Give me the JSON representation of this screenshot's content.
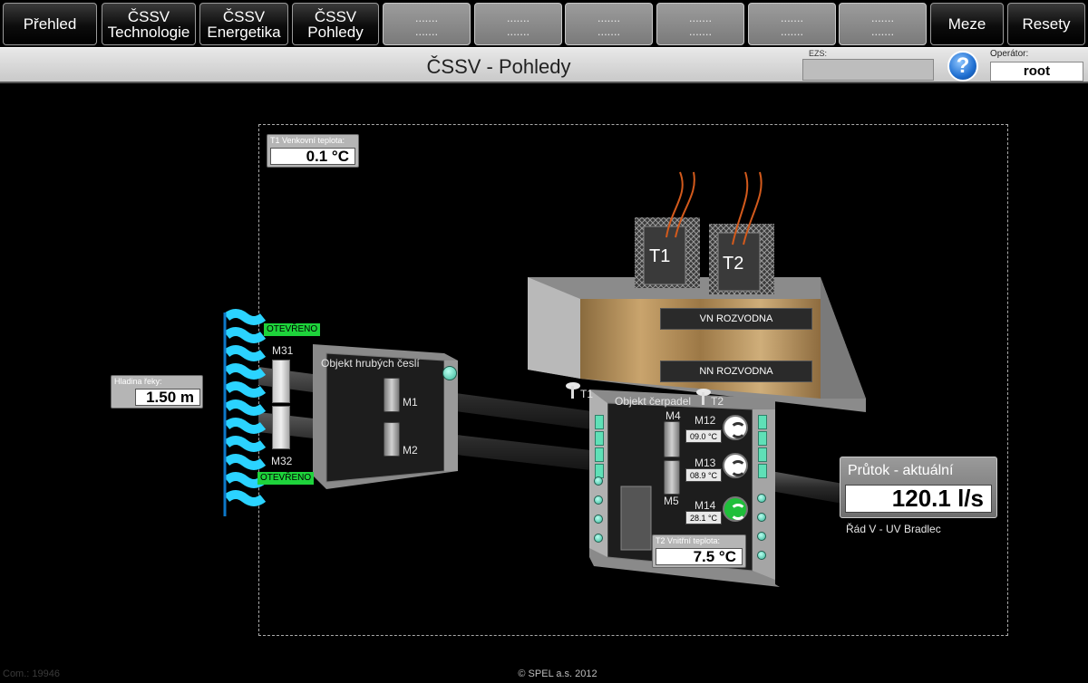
{
  "nav": {
    "btn_prehled": "Přehled",
    "btn_tech_1": "ČSSV",
    "btn_tech_2": "Technologie",
    "btn_energ_1": "ČSSV",
    "btn_energ_2": "Energetika",
    "btn_pohl_1": "ČSSV",
    "btn_pohl_2": "Pohledy",
    "empty_label": ".......",
    "btn_meze": "Meze",
    "btn_resety": "Resety"
  },
  "header": {
    "title": "ČSSV - Pohledy",
    "ezs_label": "EZS:",
    "help_symbol": "?",
    "operator_label": "Operátor:",
    "operator_value": "root"
  },
  "scheme": {
    "t1_outdoor_label": "T1 Venkovní teplota:",
    "t1_outdoor_value": "0.1 °C",
    "river_level_label": "Hladina řeky:",
    "river_level_value": "1.50 m",
    "gate_top_status": "OTEVŘENO",
    "gate_bottom_status": "OTEVŘENO",
    "m31": "M31",
    "m32": "M32",
    "coarse_screens_title": "Objekt hrubých česlí",
    "m1": "M1",
    "m2": "M2",
    "transformer_1": "T1",
    "transformer_2": "T2",
    "vn_room": "VN ROZVODNA",
    "nn_room": "NN ROZVODNA",
    "sensor_t1": "T1",
    "sensor_t2": "T2",
    "pump_station_title": "Objekt čerpadel",
    "m4": "M4",
    "m5": "M5",
    "m12": "M12",
    "m12_temp": "09.0 °C",
    "m13": "M13",
    "m13_temp": "08.9 °C",
    "m14": "M14",
    "m14_temp": "28.1 °C",
    "t2_indoor_label": "T2 Vnitřní teplota:",
    "t2_indoor_value": "7.5 °C",
    "flow_label": "Průtok - aktuální",
    "flow_value": "120.1 l/s",
    "flow_destination": "Řád V - UV Bradlec"
  },
  "footer": {
    "com": "Com.: 19946",
    "copyright": "© SPEL a.s. 2012"
  },
  "colors": {
    "status_green": "#1ed33b",
    "water_cyan": "#2bd3ff",
    "led_teal": "#5fe0b7",
    "cable_orange": "#d35a1c"
  }
}
